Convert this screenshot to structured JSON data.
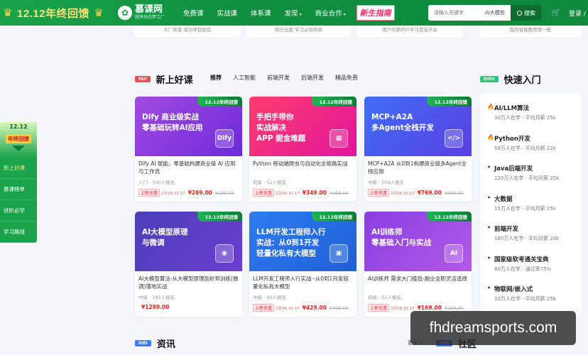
{
  "header": {
    "promo_text": "12.12年终回馈",
    "logo_name": "慕课网",
    "logo_slogan": "程序员的梦工厂",
    "nav": [
      {
        "label": "免费课"
      },
      {
        "label": "实战课"
      },
      {
        "label": "体系课"
      },
      {
        "label": "发现",
        "caret": "▾"
      },
      {
        "label": "商业合作",
        "caret": "▾"
      }
    ],
    "guide_label": "新生指南",
    "search_placeholder": "请输入关键字",
    "search_tag": "AI大模型",
    "search_button": "搜索",
    "cart_icon": "cart-icon",
    "login": "登录 /"
  },
  "top_stubs": [
    "大厂背景 成功项目经验",
    "知识全面 学习必有所获",
    "用户信赖的IT学习首选平台",
    "国内智能教育第一股"
  ],
  "sidebar": {
    "year": "12.12",
    "badge": "年终回馈",
    "items": [
      {
        "label": "新上好课",
        "active": true
      },
      {
        "label": "慕课榜单",
        "active": false
      },
      {
        "label": "进阶必学",
        "active": false
      },
      {
        "label": "学习路线",
        "active": false
      }
    ]
  },
  "new_courses": {
    "badge": "Hot",
    "title": "新上好课",
    "tabs": [
      "推荐",
      "人工智能",
      "前端开发",
      "后端开发",
      "精品免费"
    ]
  },
  "quick_start": {
    "badge": "Intro",
    "title": "快速入门",
    "items": [
      {
        "name": "AI/LLM算法",
        "sub": "30万人在学 · 平均月薪 25k",
        "hot": true
      },
      {
        "name": "Python开发",
        "sub": "58万人在学 · 平均月薪 22k",
        "hot": true
      },
      {
        "name": "Java后端开发",
        "sub": "120万人在学 · 平均月薪 25k",
        "hot": false
      },
      {
        "name": "大数据",
        "sub": "15万人在学 · 平均月薪 25k",
        "hot": false
      },
      {
        "name": "前端开发",
        "sub": "180万人在学 · 平均月薪 20k",
        "hot": false
      },
      {
        "name": "国家级软考通关宝典",
        "sub": "80万人在学 · 通过率75%",
        "hot": false
      },
      {
        "name": "物联网/嵌入式",
        "sub": "10万人在学 · 平均月薪 25k",
        "hot": false
      }
    ]
  },
  "courses": [
    {
      "ribbon": "12.12年终回馈",
      "banner": [
        "Dify 商业级实战",
        "零基础玩转AI应用"
      ],
      "art": "Dify",
      "color1": "#a24ae0",
      "color2": "#6c2bd9",
      "title": "Dify AI 赋能，零基础构建商业级 AI 应用与工作流",
      "meta": "入门 · 100人报名",
      "tag": "上新优惠",
      "countdown": "2天08:32:17",
      "price": "¥269.00",
      "old_price": "¥299.00"
    },
    {
      "ribbon": "12.12年终回馈",
      "banner": [
        "手把手带你",
        "实战解决",
        "APP 掘金难题"
      ],
      "art": "▦",
      "color1": "#ff3c6e",
      "color2": "#e0169c",
      "title": "Python 移动端爬虫与自动化全链路实战",
      "meta": "初级 · 52人报名",
      "tag": "上新优惠",
      "countdown": "2天08:32:17",
      "price": "¥349.00",
      "old_price": "¥399.00"
    },
    {
      "ribbon": "12.12年终回馈",
      "banner": [
        "MCP+A2A",
        "多Agent全栈开发"
      ],
      "art": "</>",
      "color1": "#3f6ef5",
      "color2": "#5a3fe0",
      "title": "MCP+A2A 从0到1构建商业级多Agent全栈应用",
      "meta": "中级 · 204人报名",
      "tag": "上新优惠",
      "countdown": "2天08:32:17",
      "price": "¥769.00",
      "old_price": "¥900.00"
    },
    {
      "ribbon": "12.12年终回馈",
      "banner": [
        "AI大模型原理",
        "与微调"
      ],
      "art": "◉",
      "color1": "#4b3fb8",
      "color2": "#6b3ed1",
      "title": "AI大模型算法-从大模型原理剖析到训练(微调)落地实战",
      "meta": "中级 · 185人报名",
      "tag": "",
      "countdown": "",
      "price": "¥1299.00",
      "old_price": ""
    },
    {
      "ribbon": "12.12年终回馈",
      "banner": [
        "LLM开发工程师入行",
        "实战：从0到1开发",
        "轻量化私有大模型"
      ],
      "art": "▣",
      "color1": "#2e7bf0",
      "color2": "#1f5fd6",
      "title": "LLM开发工程师入行实战--从0到1开发轻量化私有大模型",
      "meta": "中级 · 95人报名",
      "tag": "上新优惠",
      "countdown": "2天08:32:17",
      "price": "¥429.00",
      "old_price": "¥499.00"
    },
    {
      "ribbon": "12.12年终回馈",
      "banner": [
        "AI训练师",
        "零基础入门与实战"
      ],
      "art": "AI",
      "color1": "#8a3ee0",
      "color2": "#b15ae8",
      "title": "AI训练师 需求大门槛低-副业全职灵活选择",
      "meta": "初级 · 51人报名",
      "tag": "上新优惠",
      "countdown": "2天08:32:17",
      "price": "¥169.00",
      "old_price": "¥199.00"
    }
  ],
  "info": {
    "badge": "Info",
    "title": "资讯",
    "more": "更多 >"
  },
  "community": {
    "badge": "Info",
    "title": "社区"
  },
  "watermark": "fhdreamsports.com"
}
